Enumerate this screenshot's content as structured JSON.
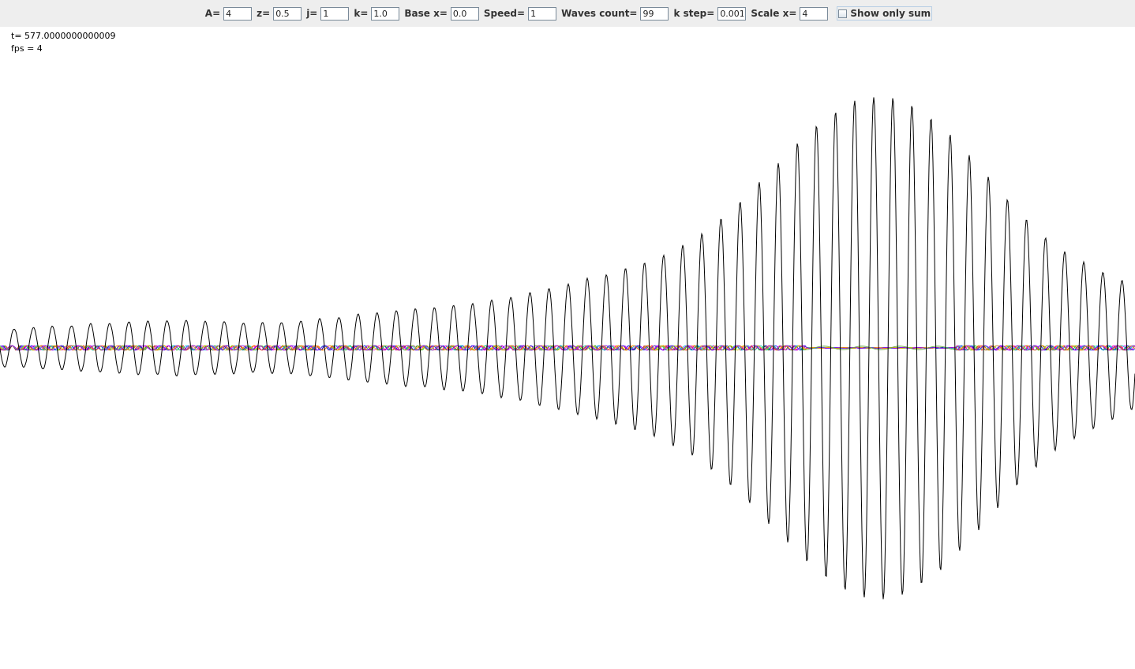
{
  "controls": {
    "a_label": "A=",
    "a_value": "4",
    "z_label": "z=",
    "z_value": "0.5",
    "j_label": "j=",
    "j_value": "1",
    "k_label": "k=",
    "k_value": "1.0",
    "base_x_label": "Base x=",
    "base_x_value": "0.0",
    "speed_label": "Speed=",
    "speed_value": "1",
    "waves_count_label": "Waves count=",
    "waves_count_value": "99",
    "k_step_label": "k step=",
    "k_step_value": "0.001",
    "scale_x_label": "Scale x=",
    "scale_x_value": "4",
    "show_only_sum_label": "Show only sum",
    "show_only_sum_checked": false
  },
  "status": {
    "t_text": "t= 577.0000000000009",
    "fps_text": "fps = 4"
  },
  "colors": {
    "toolbar_bg": "#eeeeee",
    "canvas_bg": "#ffffff",
    "sum_wave": "#000000",
    "component_waves": [
      "#ff0000",
      "#00c000",
      "#0000ff",
      "#ff00ff",
      "#00c8c8",
      "#c8c800",
      "#ff8000",
      "#8000ff"
    ]
  }
}
